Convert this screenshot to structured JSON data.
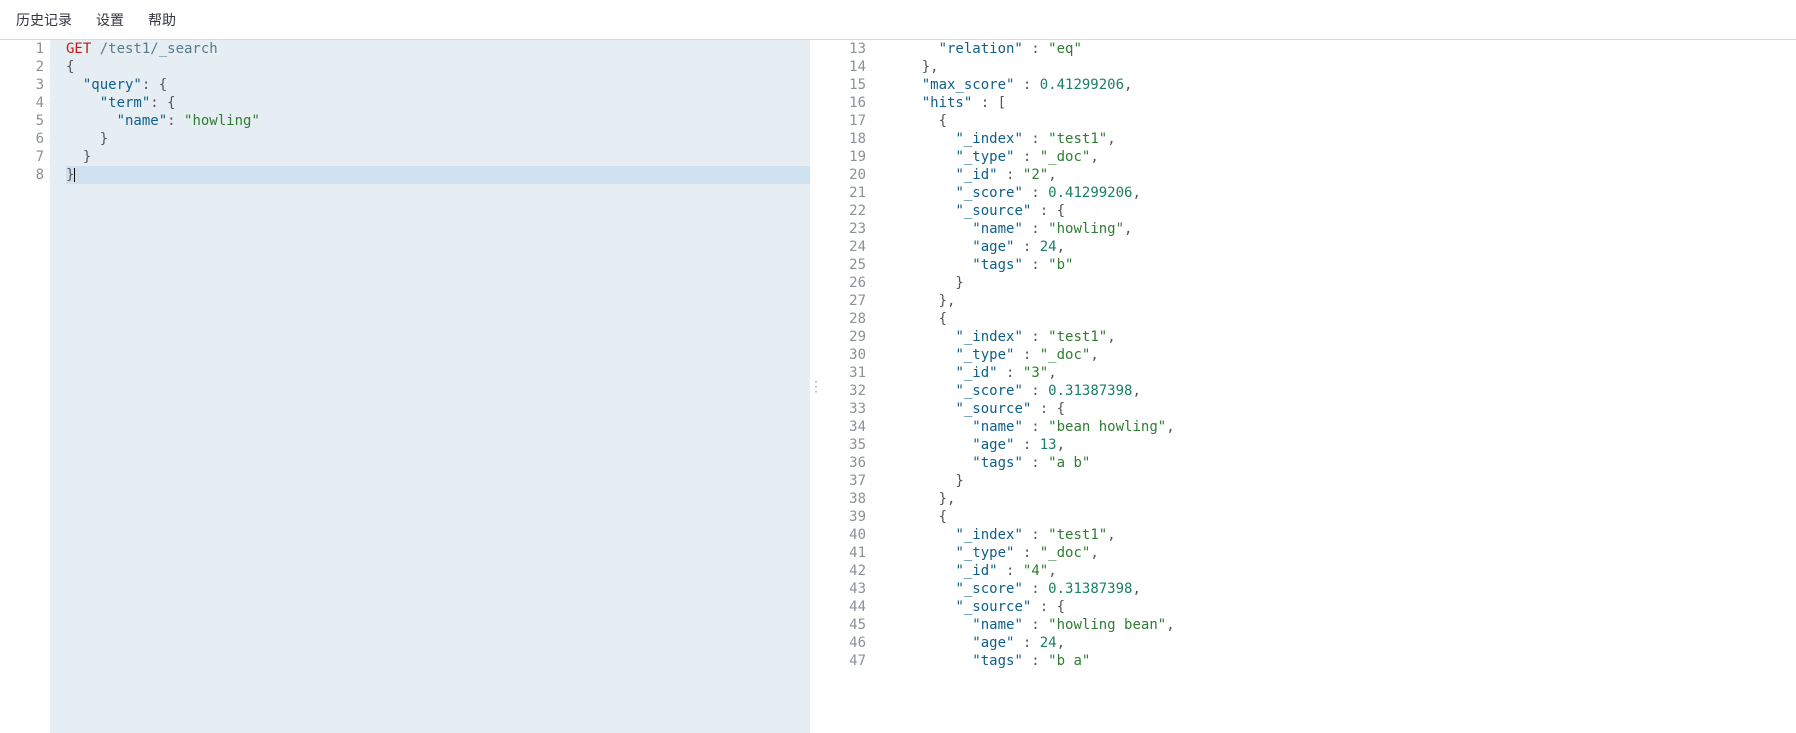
{
  "menu": {
    "history": "历史记录",
    "settings": "设置",
    "help": "帮助"
  },
  "request": {
    "lines": [
      {
        "n": "1",
        "fold": "",
        "tokens": [
          {
            "t": "GET ",
            "c": "t-method"
          },
          {
            "t": "/test1/_search",
            "c": "t-url"
          }
        ]
      },
      {
        "n": "2",
        "fold": "▾",
        "tokens": [
          {
            "t": "{",
            "c": "t-punc"
          }
        ]
      },
      {
        "n": "3",
        "fold": "▾",
        "tokens": [
          {
            "t": "  ",
            "c": ""
          },
          {
            "t": "\"query\"",
            "c": "t-key"
          },
          {
            "t": ": {",
            "c": "t-punc"
          }
        ]
      },
      {
        "n": "4",
        "fold": "▾",
        "tokens": [
          {
            "t": "    ",
            "c": "guide"
          },
          {
            "t": "\"term\"",
            "c": "t-key"
          },
          {
            "t": ": {",
            "c": "t-punc"
          }
        ]
      },
      {
        "n": "5",
        "fold": "",
        "tokens": [
          {
            "t": "      ",
            "c": "guide"
          },
          {
            "t": "\"name\"",
            "c": "t-key"
          },
          {
            "t": ": ",
            "c": "t-punc"
          },
          {
            "t": "\"howling\"",
            "c": "t-str"
          }
        ]
      },
      {
        "n": "6",
        "fold": "▴",
        "tokens": [
          {
            "t": "    ",
            "c": "guide"
          },
          {
            "t": "}",
            "c": "t-punc"
          }
        ]
      },
      {
        "n": "7",
        "fold": "▴",
        "tokens": [
          {
            "t": "  ",
            "c": "guide"
          },
          {
            "t": "}",
            "c": "t-punc"
          }
        ]
      },
      {
        "n": "8",
        "fold": "▴",
        "tokens": [
          {
            "t": "}",
            "c": "t-punc"
          }
        ],
        "active": true,
        "cursor": true
      }
    ]
  },
  "response": {
    "lines": [
      {
        "n": "13",
        "fold": "",
        "tokens": [
          {
            "t": "      ",
            "c": ""
          },
          {
            "t": "\"relation\"",
            "c": "t-key"
          },
          {
            "t": " : ",
            "c": "t-punc"
          },
          {
            "t": "\"eq\"",
            "c": "t-str"
          }
        ]
      },
      {
        "n": "14",
        "fold": "▴",
        "tokens": [
          {
            "t": "    },",
            "c": "t-punc"
          }
        ]
      },
      {
        "n": "15",
        "fold": "",
        "tokens": [
          {
            "t": "    ",
            "c": ""
          },
          {
            "t": "\"max_score\"",
            "c": "t-key"
          },
          {
            "t": " : ",
            "c": "t-punc"
          },
          {
            "t": "0.41299206",
            "c": "t-num"
          },
          {
            "t": ",",
            "c": "t-punc"
          }
        ]
      },
      {
        "n": "16",
        "fold": "▾",
        "tokens": [
          {
            "t": "    ",
            "c": ""
          },
          {
            "t": "\"hits\"",
            "c": "t-key"
          },
          {
            "t": " : [",
            "c": "t-punc"
          }
        ]
      },
      {
        "n": "17",
        "fold": "▾",
        "tokens": [
          {
            "t": "      {",
            "c": "t-punc"
          }
        ]
      },
      {
        "n": "18",
        "fold": "",
        "tokens": [
          {
            "t": "        ",
            "c": ""
          },
          {
            "t": "\"_index\"",
            "c": "t-key"
          },
          {
            "t": " : ",
            "c": "t-punc"
          },
          {
            "t": "\"test1\"",
            "c": "t-str"
          },
          {
            "t": ",",
            "c": "t-punc"
          }
        ]
      },
      {
        "n": "19",
        "fold": "",
        "tokens": [
          {
            "t": "        ",
            "c": ""
          },
          {
            "t": "\"_type\"",
            "c": "t-key"
          },
          {
            "t": " : ",
            "c": "t-punc"
          },
          {
            "t": "\"_doc\"",
            "c": "t-str"
          },
          {
            "t": ",",
            "c": "t-punc"
          }
        ]
      },
      {
        "n": "20",
        "fold": "",
        "tokens": [
          {
            "t": "        ",
            "c": ""
          },
          {
            "t": "\"_id\"",
            "c": "t-key"
          },
          {
            "t": " : ",
            "c": "t-punc"
          },
          {
            "t": "\"2\"",
            "c": "t-str"
          },
          {
            "t": ",",
            "c": "t-punc"
          }
        ]
      },
      {
        "n": "21",
        "fold": "",
        "tokens": [
          {
            "t": "        ",
            "c": ""
          },
          {
            "t": "\"_score\"",
            "c": "t-key"
          },
          {
            "t": " : ",
            "c": "t-punc"
          },
          {
            "t": "0.41299206",
            "c": "t-num"
          },
          {
            "t": ",",
            "c": "t-punc"
          }
        ]
      },
      {
        "n": "22",
        "fold": "▾",
        "tokens": [
          {
            "t": "        ",
            "c": ""
          },
          {
            "t": "\"_source\"",
            "c": "t-key"
          },
          {
            "t": " : {",
            "c": "t-punc"
          }
        ]
      },
      {
        "n": "23",
        "fold": "",
        "tokens": [
          {
            "t": "          ",
            "c": ""
          },
          {
            "t": "\"name\"",
            "c": "t-key"
          },
          {
            "t": " : ",
            "c": "t-punc"
          },
          {
            "t": "\"howling\"",
            "c": "t-str"
          },
          {
            "t": ",",
            "c": "t-punc"
          }
        ]
      },
      {
        "n": "24",
        "fold": "",
        "tokens": [
          {
            "t": "          ",
            "c": ""
          },
          {
            "t": "\"age\"",
            "c": "t-key"
          },
          {
            "t": " : ",
            "c": "t-punc"
          },
          {
            "t": "24",
            "c": "t-num"
          },
          {
            "t": ",",
            "c": "t-punc"
          }
        ]
      },
      {
        "n": "25",
        "fold": "",
        "tokens": [
          {
            "t": "          ",
            "c": ""
          },
          {
            "t": "\"tags\"",
            "c": "t-key"
          },
          {
            "t": " : ",
            "c": "t-punc"
          },
          {
            "t": "\"b\"",
            "c": "t-str"
          }
        ]
      },
      {
        "n": "26",
        "fold": "▴",
        "tokens": [
          {
            "t": "        }",
            "c": "t-punc"
          }
        ]
      },
      {
        "n": "27",
        "fold": "▴",
        "tokens": [
          {
            "t": "      },",
            "c": "t-punc"
          }
        ]
      },
      {
        "n": "28",
        "fold": "▾",
        "tokens": [
          {
            "t": "      {",
            "c": "t-punc"
          }
        ]
      },
      {
        "n": "29",
        "fold": "",
        "tokens": [
          {
            "t": "        ",
            "c": ""
          },
          {
            "t": "\"_index\"",
            "c": "t-key"
          },
          {
            "t": " : ",
            "c": "t-punc"
          },
          {
            "t": "\"test1\"",
            "c": "t-str"
          },
          {
            "t": ",",
            "c": "t-punc"
          }
        ]
      },
      {
        "n": "30",
        "fold": "",
        "tokens": [
          {
            "t": "        ",
            "c": ""
          },
          {
            "t": "\"_type\"",
            "c": "t-key"
          },
          {
            "t": " : ",
            "c": "t-punc"
          },
          {
            "t": "\"_doc\"",
            "c": "t-str"
          },
          {
            "t": ",",
            "c": "t-punc"
          }
        ]
      },
      {
        "n": "31",
        "fold": "",
        "tokens": [
          {
            "t": "        ",
            "c": ""
          },
          {
            "t": "\"_id\"",
            "c": "t-key"
          },
          {
            "t": " : ",
            "c": "t-punc"
          },
          {
            "t": "\"3\"",
            "c": "t-str"
          },
          {
            "t": ",",
            "c": "t-punc"
          }
        ]
      },
      {
        "n": "32",
        "fold": "",
        "tokens": [
          {
            "t": "        ",
            "c": ""
          },
          {
            "t": "\"_score\"",
            "c": "t-key"
          },
          {
            "t": " : ",
            "c": "t-punc"
          },
          {
            "t": "0.31387398",
            "c": "t-num"
          },
          {
            "t": ",",
            "c": "t-punc"
          }
        ]
      },
      {
        "n": "33",
        "fold": "▾",
        "tokens": [
          {
            "t": "        ",
            "c": ""
          },
          {
            "t": "\"_source\"",
            "c": "t-key"
          },
          {
            "t": " : {",
            "c": "t-punc"
          }
        ]
      },
      {
        "n": "34",
        "fold": "",
        "tokens": [
          {
            "t": "          ",
            "c": ""
          },
          {
            "t": "\"name\"",
            "c": "t-key"
          },
          {
            "t": " : ",
            "c": "t-punc"
          },
          {
            "t": "\"bean howling\"",
            "c": "t-str"
          },
          {
            "t": ",",
            "c": "t-punc"
          }
        ]
      },
      {
        "n": "35",
        "fold": "",
        "tokens": [
          {
            "t": "          ",
            "c": ""
          },
          {
            "t": "\"age\"",
            "c": "t-key"
          },
          {
            "t": " : ",
            "c": "t-punc"
          },
          {
            "t": "13",
            "c": "t-num"
          },
          {
            "t": ",",
            "c": "t-punc"
          }
        ]
      },
      {
        "n": "36",
        "fold": "",
        "tokens": [
          {
            "t": "          ",
            "c": ""
          },
          {
            "t": "\"tags\"",
            "c": "t-key"
          },
          {
            "t": " : ",
            "c": "t-punc"
          },
          {
            "t": "\"a b\"",
            "c": "t-str"
          }
        ]
      },
      {
        "n": "37",
        "fold": "▴",
        "tokens": [
          {
            "t": "        }",
            "c": "t-punc"
          }
        ]
      },
      {
        "n": "38",
        "fold": "▴",
        "tokens": [
          {
            "t": "      },",
            "c": "t-punc"
          }
        ]
      },
      {
        "n": "39",
        "fold": "▾",
        "tokens": [
          {
            "t": "      {",
            "c": "t-punc"
          }
        ]
      },
      {
        "n": "40",
        "fold": "",
        "tokens": [
          {
            "t": "        ",
            "c": ""
          },
          {
            "t": "\"_index\"",
            "c": "t-key"
          },
          {
            "t": " : ",
            "c": "t-punc"
          },
          {
            "t": "\"test1\"",
            "c": "t-str"
          },
          {
            "t": ",",
            "c": "t-punc"
          }
        ]
      },
      {
        "n": "41",
        "fold": "",
        "tokens": [
          {
            "t": "        ",
            "c": ""
          },
          {
            "t": "\"_type\"",
            "c": "t-key"
          },
          {
            "t": " : ",
            "c": "t-punc"
          },
          {
            "t": "\"_doc\"",
            "c": "t-str"
          },
          {
            "t": ",",
            "c": "t-punc"
          }
        ]
      },
      {
        "n": "42",
        "fold": "",
        "tokens": [
          {
            "t": "        ",
            "c": ""
          },
          {
            "t": "\"_id\"",
            "c": "t-key"
          },
          {
            "t": " : ",
            "c": "t-punc"
          },
          {
            "t": "\"4\"",
            "c": "t-str"
          },
          {
            "t": ",",
            "c": "t-punc"
          }
        ]
      },
      {
        "n": "43",
        "fold": "",
        "tokens": [
          {
            "t": "        ",
            "c": ""
          },
          {
            "t": "\"_score\"",
            "c": "t-key"
          },
          {
            "t": " : ",
            "c": "t-punc"
          },
          {
            "t": "0.31387398",
            "c": "t-num"
          },
          {
            "t": ",",
            "c": "t-punc"
          }
        ]
      },
      {
        "n": "44",
        "fold": "▾",
        "tokens": [
          {
            "t": "        ",
            "c": ""
          },
          {
            "t": "\"_source\"",
            "c": "t-key"
          },
          {
            "t": " : {",
            "c": "t-punc"
          }
        ]
      },
      {
        "n": "45",
        "fold": "",
        "tokens": [
          {
            "t": "          ",
            "c": ""
          },
          {
            "t": "\"name\"",
            "c": "t-key"
          },
          {
            "t": " : ",
            "c": "t-punc"
          },
          {
            "t": "\"howling bean\"",
            "c": "t-str"
          },
          {
            "t": ",",
            "c": "t-punc"
          }
        ]
      },
      {
        "n": "46",
        "fold": "",
        "tokens": [
          {
            "t": "          ",
            "c": ""
          },
          {
            "t": "\"age\"",
            "c": "t-key"
          },
          {
            "t": " : ",
            "c": "t-punc"
          },
          {
            "t": "24",
            "c": "t-num"
          },
          {
            "t": ",",
            "c": "t-punc"
          }
        ]
      },
      {
        "n": "47",
        "fold": "",
        "tokens": [
          {
            "t": "          ",
            "c": ""
          },
          {
            "t": "\"tags\"",
            "c": "t-key"
          },
          {
            "t": " : ",
            "c": "t-punc"
          },
          {
            "t": "\"b a\"",
            "c": "t-str"
          }
        ]
      }
    ]
  }
}
